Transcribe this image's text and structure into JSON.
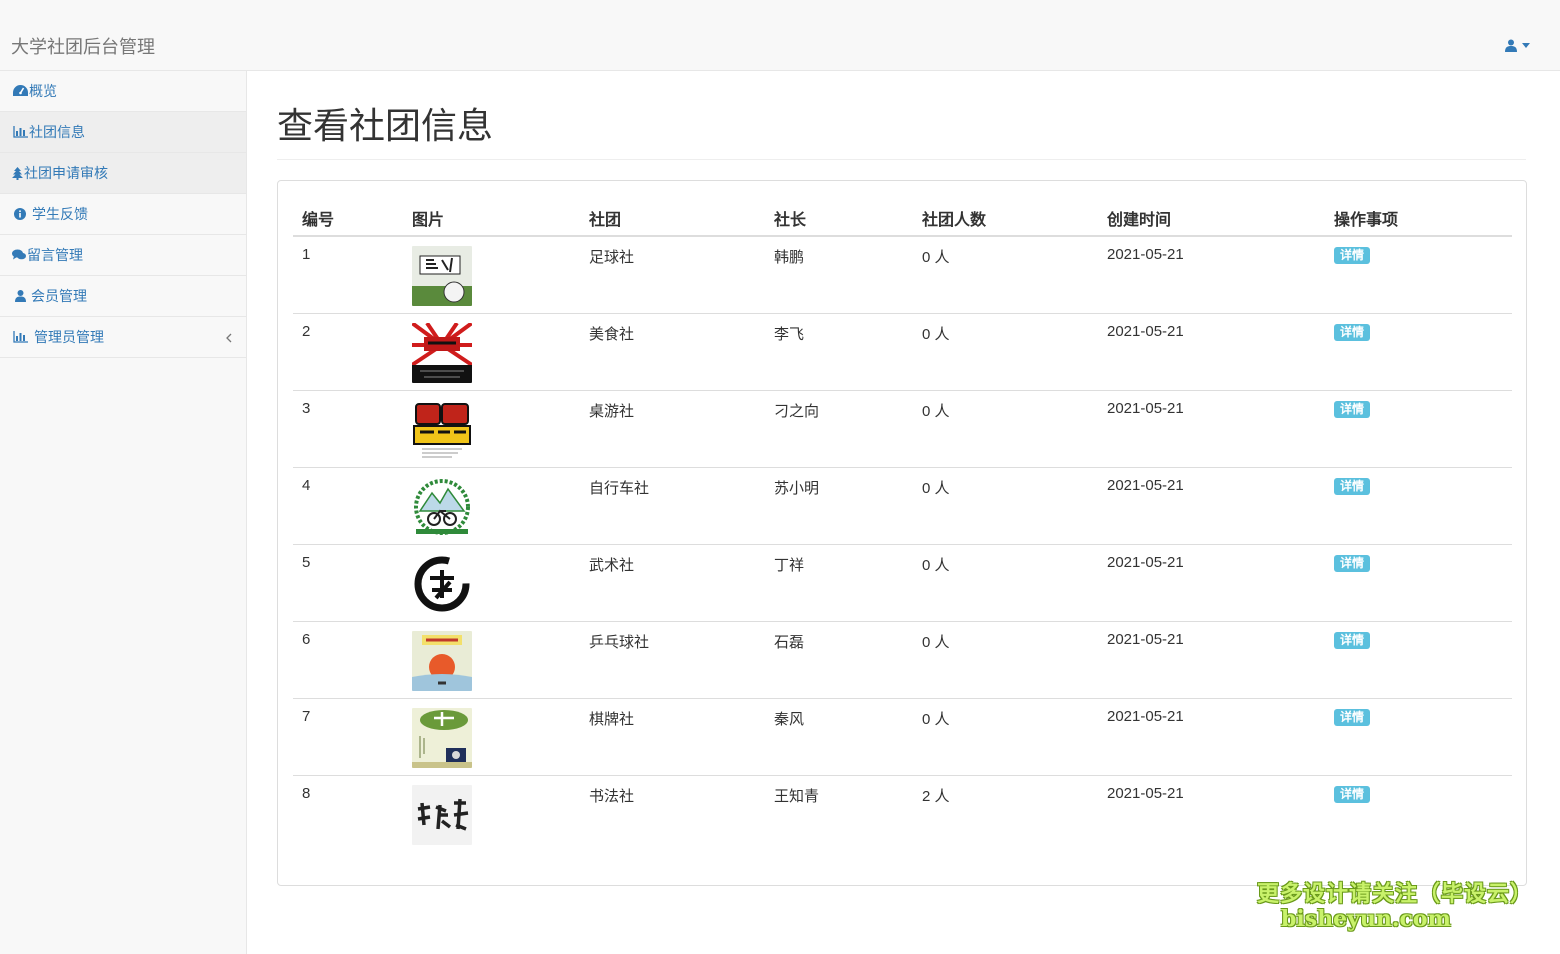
{
  "header": {
    "brand": "大学社团后台管理"
  },
  "sidebar": {
    "items": [
      {
        "label": "概览",
        "icon": "dashboard-icon"
      },
      {
        "label": "社团信息",
        "icon": "bar-chart-icon",
        "active": true
      },
      {
        "label": "社团申请审核",
        "icon": "tree-icon",
        "active": true
      },
      {
        "label": "学生反馈",
        "icon": "info-circle-icon"
      },
      {
        "label": "留言管理",
        "icon": "comments-icon"
      },
      {
        "label": "会员管理",
        "icon": "user-icon"
      },
      {
        "label": "管理员管理",
        "icon": "bar-chart-icon",
        "has_submenu": true
      }
    ]
  },
  "main": {
    "title": "查看社团信息",
    "table": {
      "headers": [
        "编号",
        "图片",
        "社团",
        "社长",
        "社团人数",
        "创建时间",
        "操作事项"
      ],
      "rows": [
        {
          "id": "1",
          "club": "足球社",
          "leader": "韩鹏",
          "members": "0 人",
          "created": "2021-05-21",
          "action": "详情"
        },
        {
          "id": "2",
          "club": "美食社",
          "leader": "李飞",
          "members": "0 人",
          "created": "2021-05-21",
          "action": "详情"
        },
        {
          "id": "3",
          "club": "桌游社",
          "leader": "刁之向",
          "members": "0 人",
          "created": "2021-05-21",
          "action": "详情"
        },
        {
          "id": "4",
          "club": "自行车社",
          "leader": "苏小明",
          "members": "0 人",
          "created": "2021-05-21",
          "action": "详情"
        },
        {
          "id": "5",
          "club": "武术社",
          "leader": "丁祥",
          "members": "0 人",
          "created": "2021-05-21",
          "action": "详情"
        },
        {
          "id": "6",
          "club": "乒乓球社",
          "leader": "石磊",
          "members": "0 人",
          "created": "2021-05-21",
          "action": "详情"
        },
        {
          "id": "7",
          "club": "棋牌社",
          "leader": "秦风",
          "members": "0 人",
          "created": "2021-05-21",
          "action": "详情"
        },
        {
          "id": "8",
          "club": "书法社",
          "leader": "王知青",
          "members": "2 人",
          "created": "2021-05-21",
          "action": "详情"
        }
      ]
    }
  },
  "watermark": {
    "line1": "更多设计请关注（毕设云）",
    "line2": "bisheyun.com"
  },
  "colors": {
    "link": "#337ab7",
    "badge": "#5bc0de",
    "navbar_bg": "#f8f8f8"
  }
}
